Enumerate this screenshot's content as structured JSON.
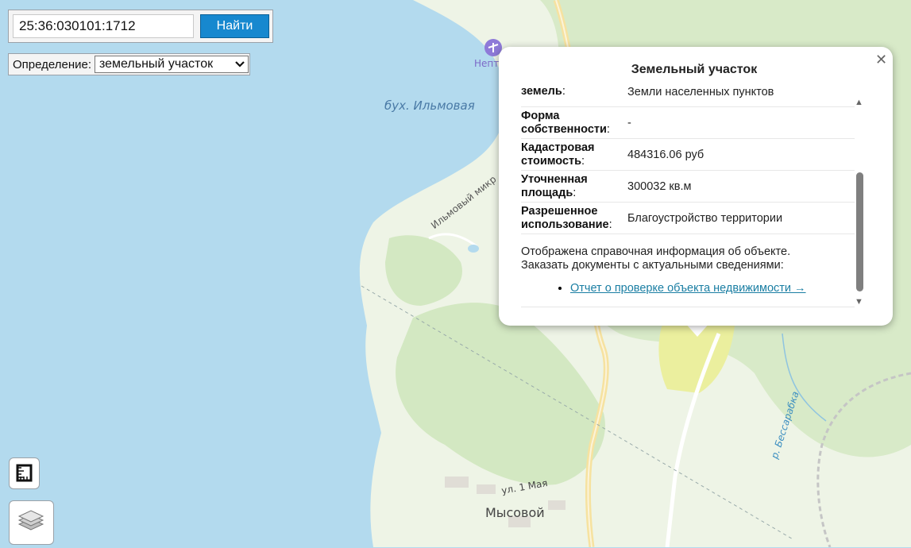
{
  "search": {
    "value": "25:36:030101:1712",
    "button_label": "Найти"
  },
  "definition": {
    "label": "Определение:",
    "selected": "земельный участок"
  },
  "popup": {
    "title": "Земельный участок",
    "close_icon": "close-icon",
    "rows": [
      {
        "key": "Категория земель",
        "key_visible": "земель",
        "value": "Земли населенных пунктов"
      },
      {
        "key": "Форма собственности",
        "value": "-"
      },
      {
        "key": "Кадастровая стоимость",
        "value": "484316.06 руб"
      },
      {
        "key": "Уточненная площадь",
        "value": "300032 кв.м"
      },
      {
        "key": "Разрешенное использование",
        "value": "Благоустройство территории"
      }
    ],
    "note_line1": "Отображена справочная информация об объекте.",
    "note_line2": "Заказать документы с актуальными сведениями:",
    "report_link": "Отчет о проверке объекта недвижимости →"
  },
  "map_labels": {
    "bay": "бух. Ильмовая",
    "street_microdistrict": "Ильмовый микр",
    "street_1may": "ул. 1 Мая",
    "village": "Мысовой",
    "river": "р. Бессарабка",
    "poi": "Непт"
  },
  "controls": {
    "ruler_icon": "ruler-icon",
    "layers_icon": "layers-icon"
  },
  "colors": {
    "water": "#b3daee",
    "land": "#e9f2e1",
    "forest": "#cfe6bd",
    "selected_parcel": "#ebef9e",
    "accent": "#1788cf",
    "link": "#1a7ea3"
  }
}
